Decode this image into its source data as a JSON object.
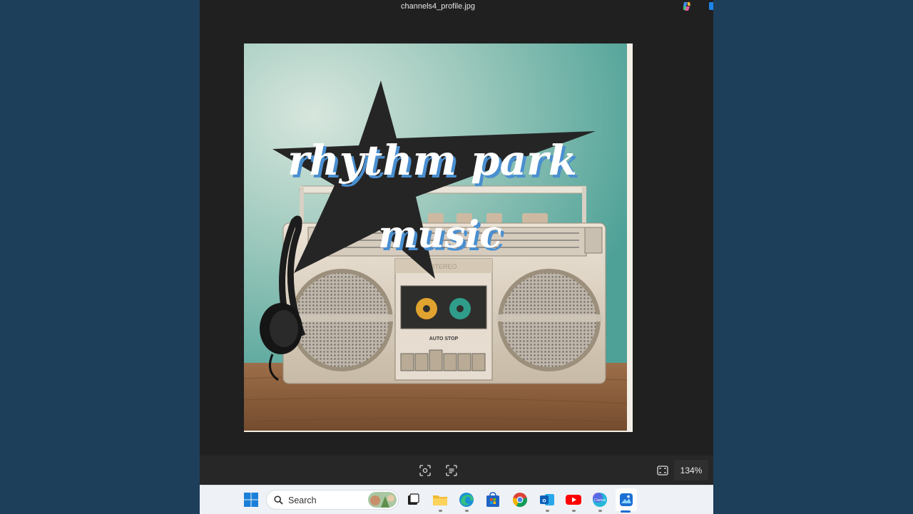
{
  "window": {
    "title": "channels4_profile.jpg"
  },
  "image": {
    "logo_text_line1": "rhythm park",
    "logo_text_line2": "music",
    "cassette_label": "STEREO",
    "deck_label": "AUTO STOP"
  },
  "toolbar": {
    "zoom_level": "134%",
    "icons": [
      "visual-search-icon",
      "text-scan-icon",
      "fit-to-window-icon"
    ]
  },
  "taskbar": {
    "search_placeholder": "Search",
    "apps": [
      "windows-start-icon",
      "task-view-icon",
      "file-explorer-icon",
      "edge-icon",
      "microsoft-store-icon",
      "chrome-icon",
      "outlook-icon",
      "youtube-icon",
      "canva-icon",
      "photos-icon"
    ]
  },
  "colors": {
    "desktop": "#1e3f5a",
    "app_background": "#202020",
    "taskbar": "#eef1f5",
    "accent": "#1c6fd3"
  }
}
